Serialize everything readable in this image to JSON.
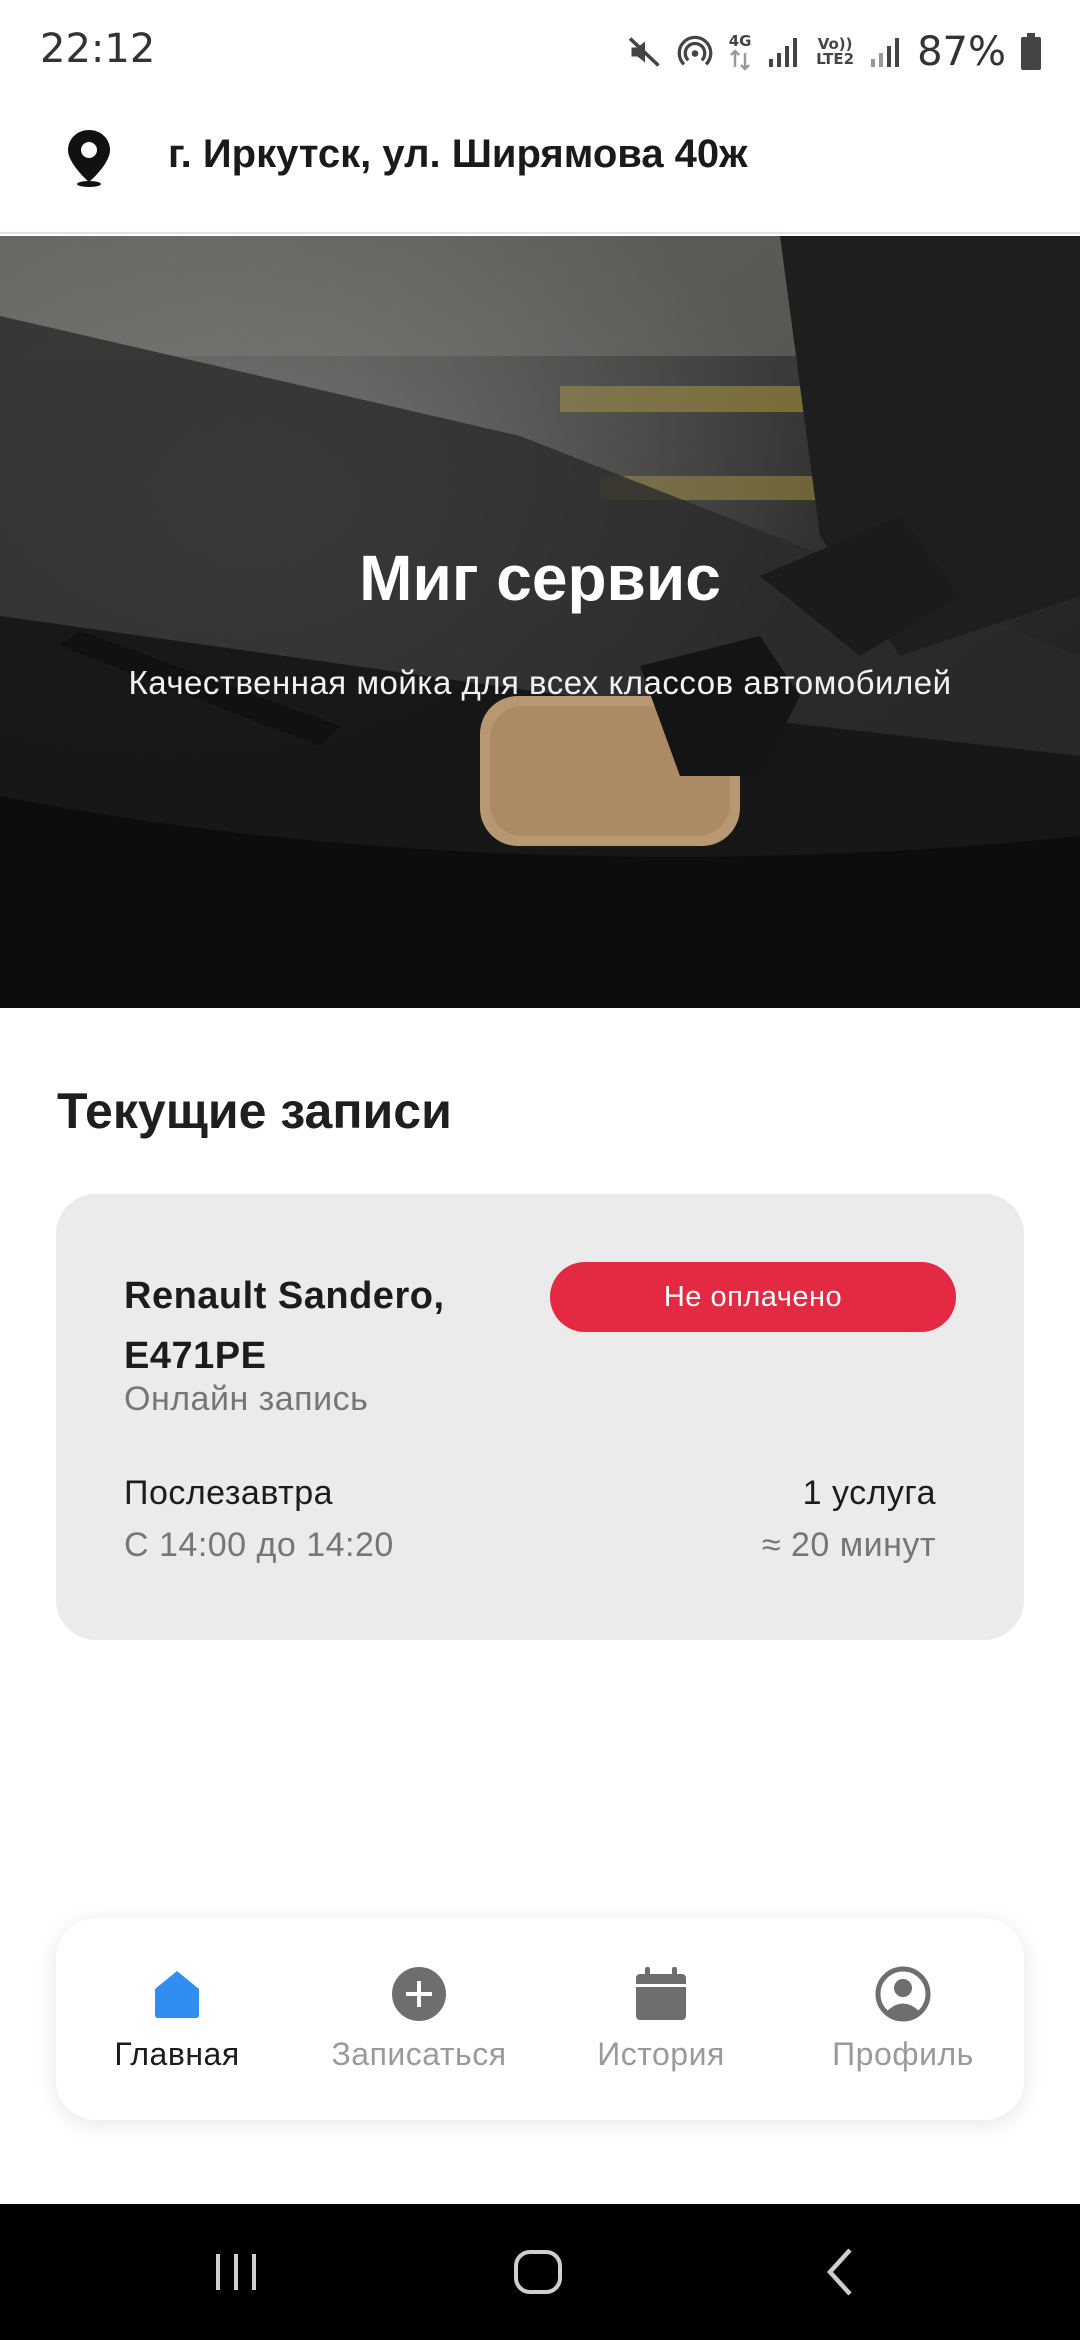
{
  "status_bar": {
    "time": "22:12",
    "network_label_top": "4G",
    "volte_label_top": "Vo))",
    "volte_label_bottom": "LTE2",
    "battery": "87%",
    "icons": [
      "mute-icon",
      "hotspot-icon",
      "data-arrows-icon",
      "signal-icon",
      "signal-icon-2",
      "battery-icon"
    ]
  },
  "location": {
    "icon": "map-pin-icon",
    "address": "г. Иркутск, ул. Ширямова 40ж"
  },
  "hero": {
    "title": "Миг сервис",
    "subtitle": "Качественная мойка для всех классов автомобилей"
  },
  "section": {
    "title": "Текущие записи"
  },
  "booking": {
    "car": "Renault Sandero, E471PE",
    "type": "Онлайн запись",
    "status": "Не оплачено",
    "status_color": "#e42a42",
    "day": "Послезавтра",
    "time_range": "С 14:00 до 14:20",
    "services": "1 услуга",
    "duration": "≈ 20 минут"
  },
  "nav": {
    "active_color": "#2f8ef0",
    "inactive_color": "#6e6e6e",
    "items": [
      {
        "label": "Главная",
        "icon": "home-icon",
        "active": true
      },
      {
        "label": "Записаться",
        "icon": "plus-circle-icon",
        "active": false
      },
      {
        "label": "История",
        "icon": "calendar-icon",
        "active": false
      },
      {
        "label": "Профиль",
        "icon": "profile-icon",
        "active": false
      }
    ]
  },
  "system_nav": {
    "buttons": [
      "recent-apps-icon",
      "home-circle-icon",
      "back-icon"
    ]
  }
}
